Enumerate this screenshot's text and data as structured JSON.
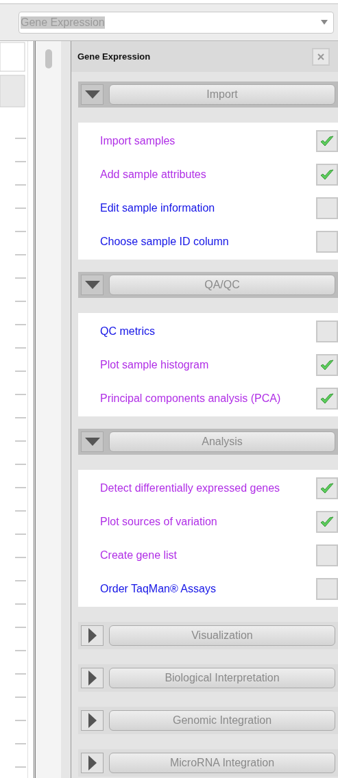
{
  "dropdown": {
    "value": "Gene Expression"
  },
  "panel": {
    "title": "Gene Expression"
  },
  "sections": [
    {
      "title": "Import",
      "expanded": true,
      "items": [
        {
          "label": "Import samples",
          "visited": true,
          "checked": true
        },
        {
          "label": "Add sample attributes",
          "visited": true,
          "checked": true
        },
        {
          "label": "Edit sample information",
          "visited": false,
          "checked": false
        },
        {
          "label": "Choose sample ID column",
          "visited": false,
          "checked": false
        }
      ]
    },
    {
      "title": "QA/QC",
      "expanded": true,
      "items": [
        {
          "label": "QC metrics",
          "visited": false,
          "checked": false
        },
        {
          "label": "Plot sample histogram",
          "visited": true,
          "checked": true
        },
        {
          "label": "Principal components analysis (PCA)",
          "visited": true,
          "checked": true
        }
      ]
    },
    {
      "title": "Analysis",
      "expanded": true,
      "items": [
        {
          "label": "Detect differentially expressed genes",
          "visited": true,
          "checked": true
        },
        {
          "label": "Plot sources of variation",
          "visited": true,
          "checked": true
        },
        {
          "label": "Create gene list",
          "visited": true,
          "checked": false
        },
        {
          "label": "Order TaqMan® Assays",
          "visited": false,
          "checked": false
        }
      ]
    },
    {
      "title": "Visualization",
      "expanded": false
    },
    {
      "title": "Biological Interpretation",
      "expanded": false
    },
    {
      "title": "Genomic Integration",
      "expanded": false
    },
    {
      "title": "MicroRNA Integration",
      "expanded": false
    }
  ]
}
